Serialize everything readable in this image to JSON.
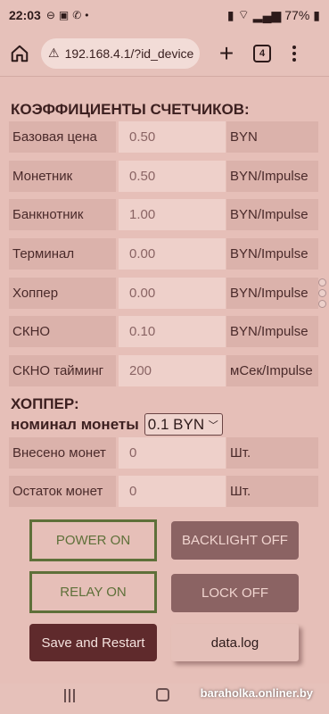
{
  "status_bar": {
    "time": "22:03",
    "battery": "77%",
    "icons": [
      "minus-circle-icon",
      "square-icon",
      "phone-icon",
      "dot-icon"
    ]
  },
  "browser": {
    "url": "192.168.4.1/?id_device",
    "tab_count": "4"
  },
  "coefficients": {
    "title": "КОЭФФИЦИЕНТЫ СЧЕТЧИКОВ:",
    "rows": [
      {
        "label": "Базовая цена",
        "value": "0.50",
        "unit": "BYN"
      },
      {
        "label": "Монетник",
        "value": "0.50",
        "unit": "BYN/Impulse"
      },
      {
        "label": "Банкнотник",
        "value": "1.00",
        "unit": "BYN/Impulse"
      },
      {
        "label": "Терминал",
        "value": "0.00",
        "unit": "BYN/Impulse"
      },
      {
        "label": "Хоппер",
        "value": "0.00",
        "unit": "BYN/Impulse"
      },
      {
        "label": "СКНО",
        "value": "0.10",
        "unit": "BYN/Impulse"
      },
      {
        "label": "СКНО тайминг",
        "value": "200",
        "unit": "мСек/Impulse"
      }
    ]
  },
  "hopper": {
    "title": "ХОППЕР:",
    "nominal_label": "номинал монеты",
    "nominal_value": "0.1 BYN",
    "rows": [
      {
        "label": "Внесено монет",
        "value": "0",
        "unit": "Шт."
      },
      {
        "label": "Остаток монет",
        "value": "0",
        "unit": "Шт."
      }
    ]
  },
  "buttons": {
    "power": "POWER ON",
    "backlight": "BACKLIGHT OFF",
    "relay": "RELAY ON",
    "lock": "LOCK OFF",
    "save": "Save and Restart",
    "datalog": "data.log"
  },
  "watermark": "baraholka.onliner.by",
  "colors": {
    "background": "#e6bfb8",
    "outline_green": "#5e7039",
    "button_dark": "#8b6363",
    "button_darkest": "#5f2a2c"
  }
}
